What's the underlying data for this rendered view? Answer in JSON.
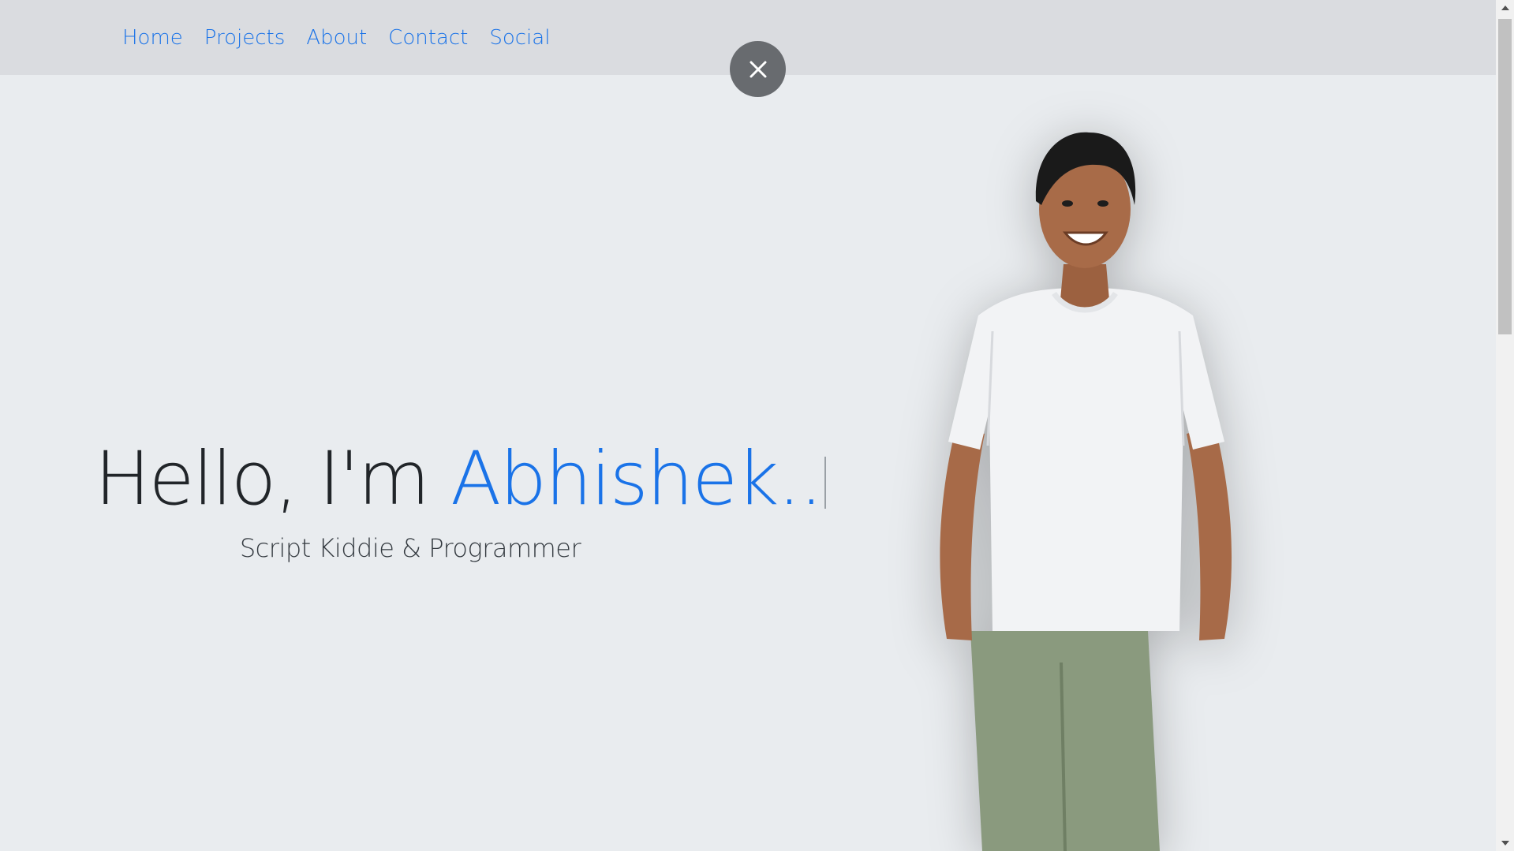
{
  "nav": {
    "items": [
      {
        "label": "Home"
      },
      {
        "label": "Projects"
      },
      {
        "label": "About"
      },
      {
        "label": "Contact"
      },
      {
        "label": "Social"
      }
    ]
  },
  "close_button": {
    "icon": "close-icon"
  },
  "hero": {
    "greeting": "Hello, I'm ",
    "name": "Abhishek..",
    "subtitle": "Script Kiddie & Programmer"
  },
  "portrait": {
    "icon": "person-photo"
  },
  "colors": {
    "accent": "#1a73e8",
    "navbar_bg": "#dadce0",
    "page_bg": "#e9ecef",
    "close_bg": "#686b6f"
  }
}
